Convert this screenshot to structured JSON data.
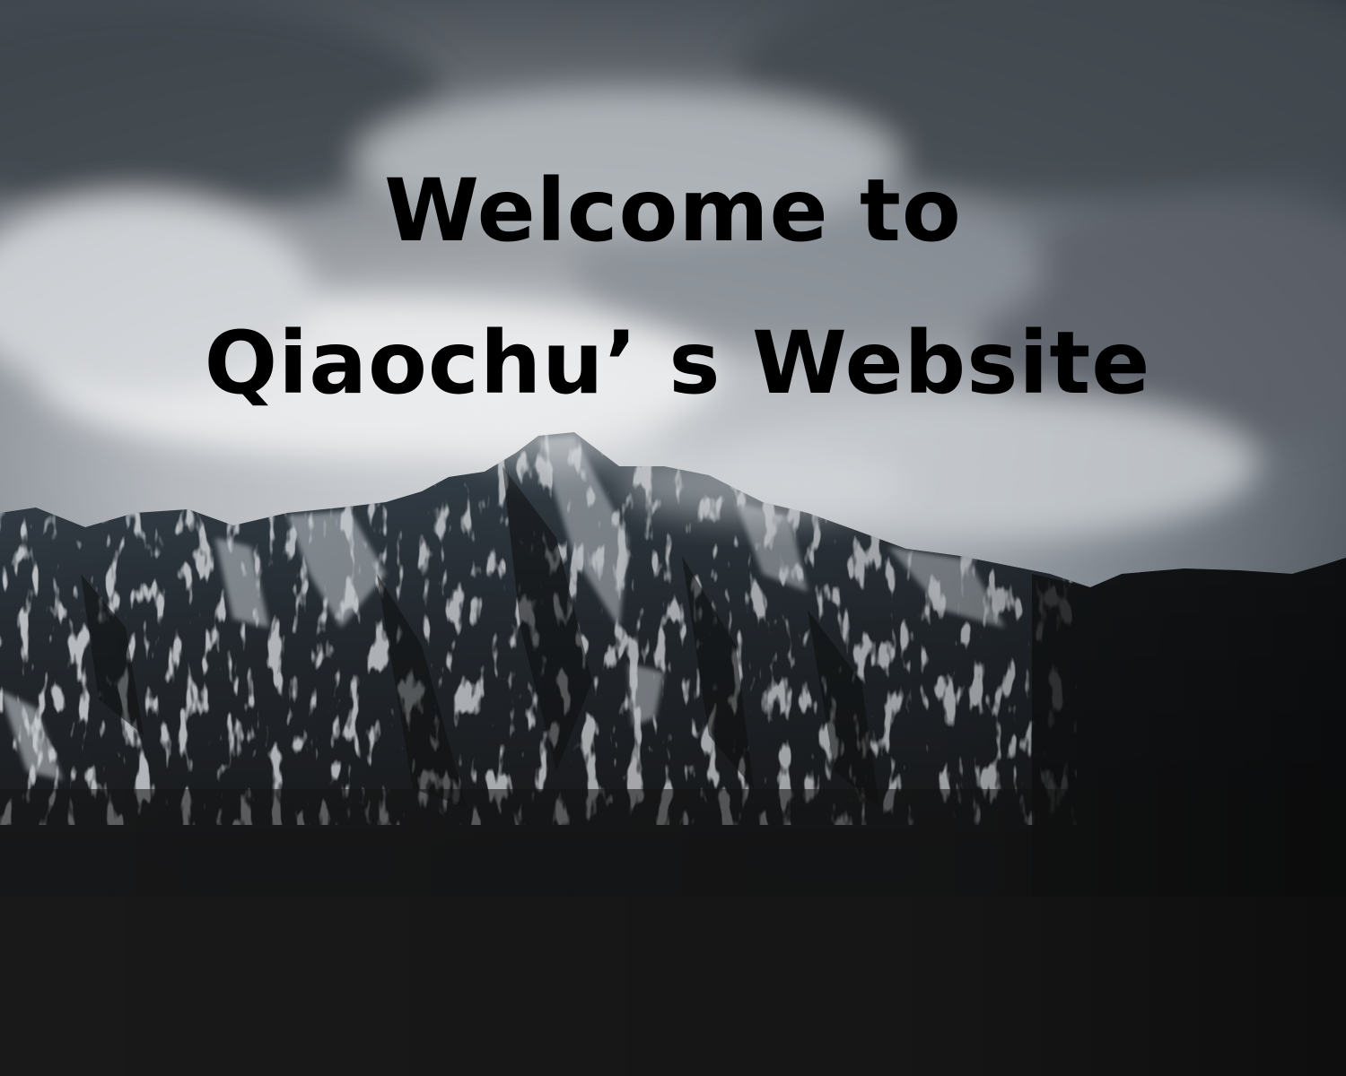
{
  "headline": {
    "line1": "Welcome to",
    "line2": "Qiaochu’ s Website"
  },
  "scene": {
    "subject": "snow-dusted-mountain-ridge",
    "sky": "overcast-clouds",
    "colors": {
      "sky_light": "#e6e8eb",
      "sky_dark": "#4a5058",
      "mountain_dark": "#1a1a1c",
      "snow": "#c9cfd6",
      "text": "#000000"
    }
  }
}
